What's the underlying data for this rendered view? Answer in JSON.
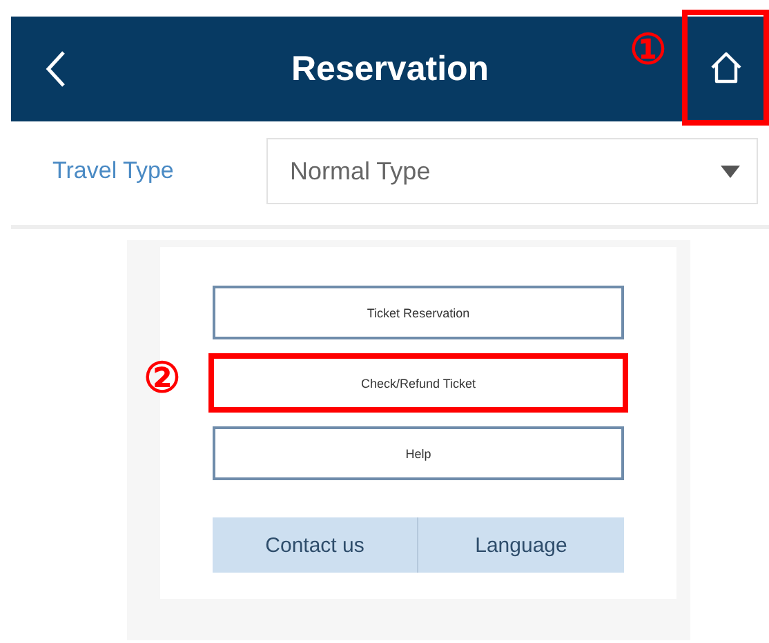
{
  "header": {
    "title": "Reservation",
    "home_highlighted": true,
    "home_annotation": "①"
  },
  "filter": {
    "label": "Travel Type",
    "value": "Normal Type"
  },
  "menu": [
    {
      "label": "Ticket Reservation",
      "highlighted": false
    },
    {
      "label": "Check/Refund Ticket",
      "highlighted": true,
      "annotation": "②"
    },
    {
      "label": "Help",
      "highlighted": false
    }
  ],
  "footer_buttons": [
    "Contact us",
    "Language"
  ]
}
